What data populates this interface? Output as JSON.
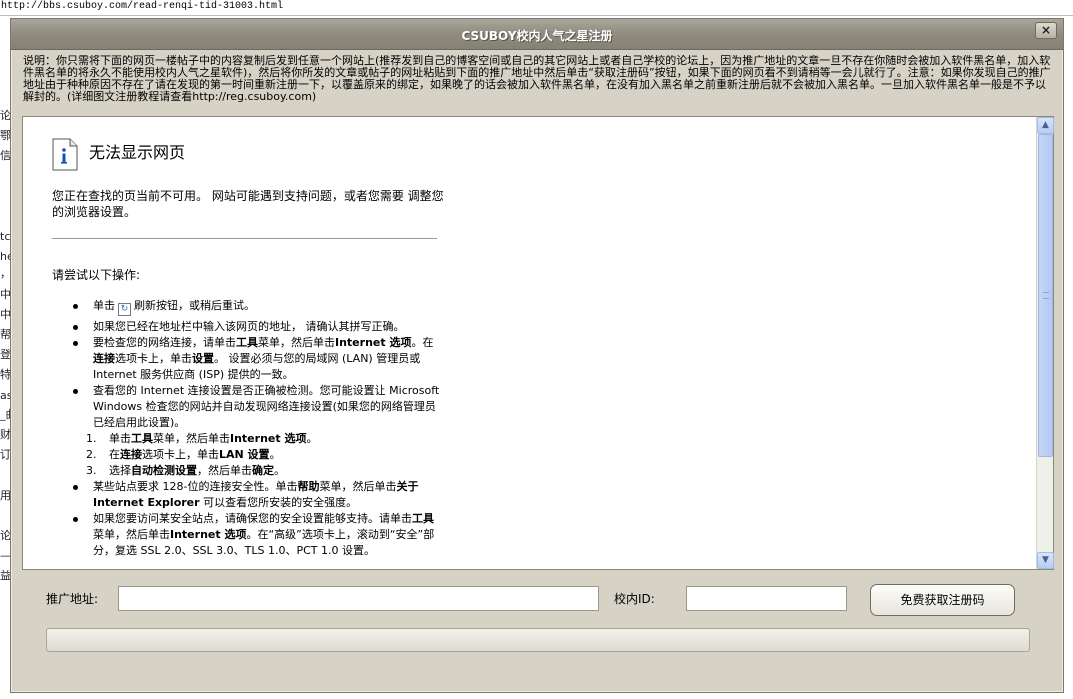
{
  "browser_url": "http://bbs.csuboy.com/read-renqi-tid-31003.html",
  "background_fragments": [
    "论:",
    "鄂",
    "信.",
    "tc",
    "he",
    "，",
    "中.",
    "中",
    "帮.",
    "登:",
    "特.",
    "as",
    "_曲",
    "财",
    "订",
    "用",
    "论:",
    "—",
    "益"
  ],
  "dialog": {
    "title": "CSUBOY校内人气之星注册",
    "close_label": "×",
    "notice": "说明：你只需将下面的网页一楼帖子中的内容复制后发到任意一个网站上(推荐发到自己的博客空间或自己的其它网站上或者自己学校的论坛上，因为推广地址的文章一旦不存在你随时会被加入软件黑名单，加入软件黑名单的将永久不能使用校内人气之星软件)，然后将你所发的文章或帖子的网址粘贴到下面的推广地址中然后单击“获取注册码”按钮，如果下面的网页看不到请稍等一会儿就行了。注意：如果你发现自己的推广地址由于种种原因不存在了请在发现的第一时间重新注册一下，以覆盖原来的绑定，如果晚了的话会被加入软件黑名单，在没有加入黑名单之前重新注册后就不会被加入黑名单。一旦加入软件黑名单一般是不予以解封的。(详细图文注册教程请查看http://reg.csuboy.com)"
  },
  "error_page": {
    "title": "无法显示网页",
    "description": "您正在查找的页当前不可用。 网站可能遇到支持问题，或者您需要 调整您的浏览器设置。",
    "try_heading": "请尝试以下操作:",
    "items": {
      "i1_a": "单击",
      "i1_b": "刷新按钮，或稍后重试。",
      "i2": "如果您已经在地址栏中输入该网页的地址， 请确认其拼写正确。",
      "i3_a": "要检查您的网络连接，请单击",
      "i3_b": "工具",
      "i3_c": "菜单，然后单击",
      "i3_d": "Internet 选项",
      "i3_e": "。在",
      "i3_f": "连接",
      "i3_g": "选项卡上，单击",
      "i3_h": "设置",
      "i3_i": "。 设置必须与您的局域网 (LAN) 管理员或 Internet 服务供应商 (ISP) 提供的一致。",
      "i4": "查看您的 Internet 连接设置是否正确被检测。您可能设置让 Microsoft Windows 检查您的网站并自动发现网络连接设置(如果您的网络管理员已经启用此设置)。",
      "s1_num": "1.",
      "s1_a": "单击",
      "s1_b": "工具",
      "s1_c": "菜单，然后单击",
      "s1_d": "Internet 选项",
      "s1_e": "。",
      "s2_num": "2.",
      "s2_a": "在",
      "s2_b": "连接",
      "s2_c": "选项卡上，单击",
      "s2_d": "LAN 设置",
      "s2_e": "。",
      "s3_num": "3.",
      "s3_a": "选择",
      "s3_b": "自动检测设置",
      "s3_c": "，然后单击",
      "s3_d": "确定",
      "s3_e": "。",
      "i5_a": "某些站点要求 128-位的连接安全性。单击",
      "i5_b": "帮助",
      "i5_c": "菜单，然后单击",
      "i5_d": "关于 Internet Explorer",
      "i5_e": " 可以查看您所安装的安全强度。",
      "i6_a": "如果您要访问某安全站点，请确保您的安全设置能够支持。请单击",
      "i6_b": "工具",
      "i6_c": "菜单，然后单击",
      "i6_d": "Internet 选项",
      "i6_e": "。在“高级”选项卡上，滚动到“安全”部分，复选 SSL 2.0、SSL 3.0、TLS 1.0、PCT 1.0 设置。"
    }
  },
  "form": {
    "promo_label": "推广地址:",
    "promo_value": "",
    "id_label": "校内ID:",
    "id_value": "",
    "get_code_button": "免费获取注册码",
    "status_text": ""
  },
  "colors": {
    "dialog_bg": "#d6d3c6",
    "titlebar": "#8f8b7f",
    "scrollbar": "#b6cdf3"
  }
}
